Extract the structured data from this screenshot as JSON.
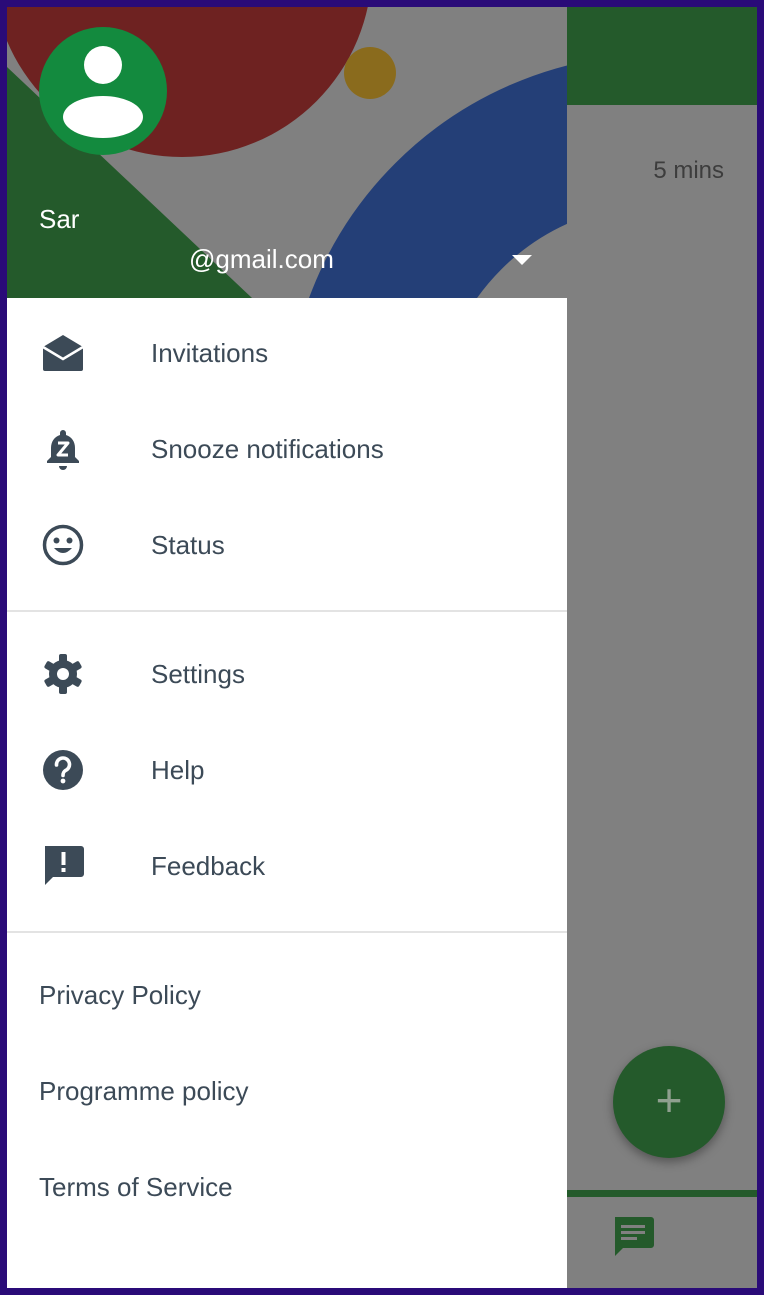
{
  "background": {
    "time_label": "5 mins",
    "fab_label": "+",
    "colors": {
      "brand_green": "#245a2b",
      "scrim": "#808080"
    }
  },
  "drawer": {
    "account": {
      "name": "Sar",
      "email": "@gmail.com"
    },
    "primary_items": [
      {
        "label": "Invitations",
        "icon": "envelope-open-icon"
      },
      {
        "label": "Snooze notifications",
        "icon": "bell-snooze-icon"
      },
      {
        "label": "Status",
        "icon": "smiley-icon"
      }
    ],
    "secondary_items": [
      {
        "label": "Settings",
        "icon": "gear-icon"
      },
      {
        "label": "Help",
        "icon": "help-circle-icon"
      },
      {
        "label": "Feedback",
        "icon": "feedback-icon"
      }
    ],
    "links": [
      {
        "label": "Privacy Policy"
      },
      {
        "label": "Programme policy"
      },
      {
        "label": "Terms of Service"
      }
    ],
    "colors": {
      "icon": "#3c4a57",
      "text": "#3c4a57",
      "avatar": "#138a3e"
    }
  }
}
